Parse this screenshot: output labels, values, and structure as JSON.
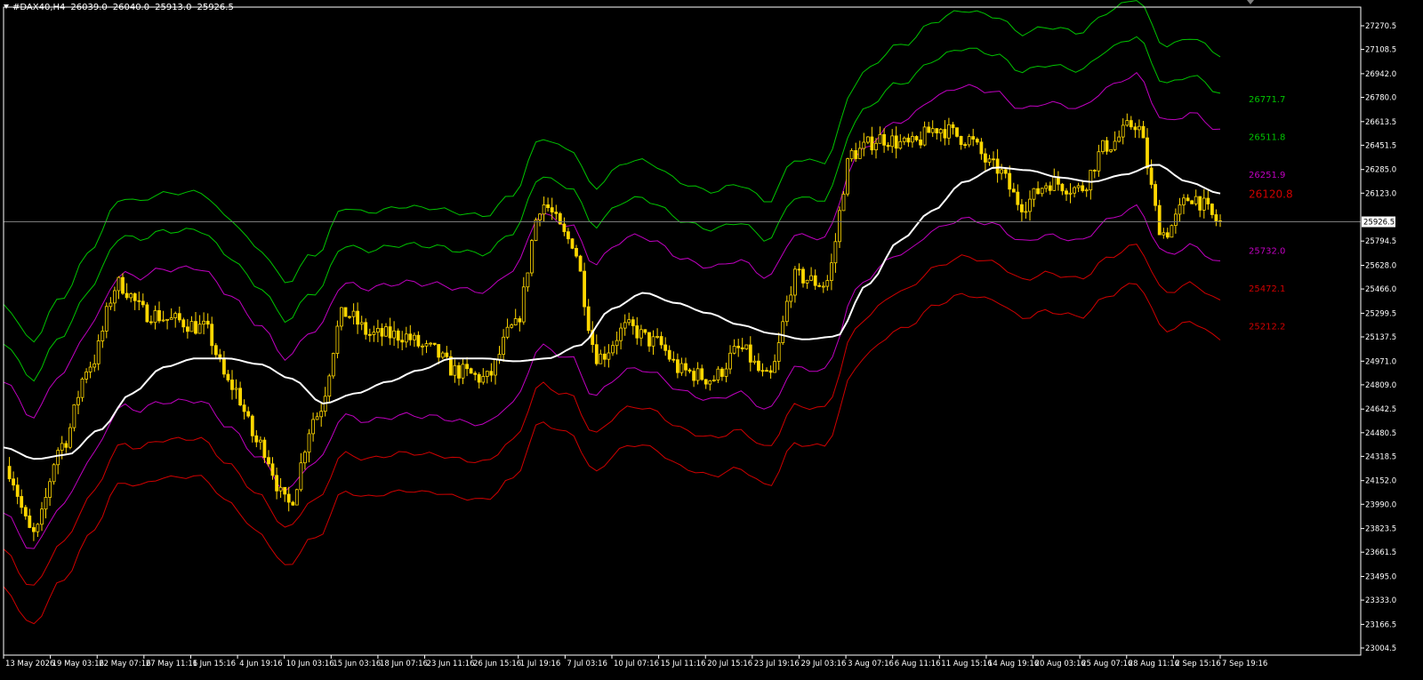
{
  "header": {
    "symbol": "#DAX40,H4",
    "ohlc": [
      "26039.0",
      "26040.0",
      "25913.0",
      "25926.5"
    ]
  },
  "colors": {
    "background": "#000000",
    "axis": "#ffffff",
    "candle": "#ffd700",
    "mid_line": "#ffffff",
    "outer_band": "#00c400",
    "middle_band": "#c000c0",
    "lower_band": "#d00000",
    "price_line": "#7a7a7a"
  },
  "chart_data": {
    "type": "candlestick",
    "instrument": "#DAX40",
    "timeframe": "H4",
    "ylim": [
      23004.5,
      27350
    ],
    "y_ticks": [
      "27270.5",
      "27108.5",
      "26942.0",
      "26780.0",
      "26613.5",
      "26451.5",
      "26285.0",
      "26123.0",
      "25794.5",
      "25628.0",
      "25466.0",
      "25299.5",
      "25137.5",
      "24971.0",
      "24809.0",
      "24642.5",
      "24480.5",
      "24318.5",
      "24152.0",
      "23990.0",
      "23823.5",
      "23661.5",
      "23495.0",
      "23333.0",
      "23166.5",
      "23004.5"
    ],
    "x_ticks": [
      "13 May 2026",
      "19 May 03:16",
      "22 May 07:16",
      "27 May 11:16",
      "1 Jun 15:16",
      "4 Jun 19:16",
      "10 Jun 03:16",
      "15 Jun 03:16",
      "18 Jun 07:16",
      "23 Jun 11:16",
      "26 Jun 15:16",
      "1 Jul 19:16",
      "7 Jul 03:16",
      "10 Jul 07:16",
      "15 Jul 11:16",
      "20 Jul 15:16",
      "23 Jul 19:16",
      "29 Jul 03:16",
      "3 Aug 07:16",
      "6 Aug 11:16",
      "11 Aug 15:16",
      "14 Aug 19:16",
      "20 Aug 03:16",
      "25 Aug 07:16",
      "28 Aug 11:16",
      "2 Sep 15:16",
      "7 Sep 19:16"
    ],
    "current_price": "25926.5",
    "current_price_value": 25926.5,
    "band_labels": [
      {
        "text": "26771.7",
        "value": 26771.7,
        "band": "outer"
      },
      {
        "text": "26511.8",
        "value": 26511.8,
        "band": "outer"
      },
      {
        "text": "26251.9",
        "value": 26251.9,
        "band": "middle"
      },
      {
        "text": "26120.8",
        "value": 26120.8,
        "band": "mid"
      },
      {
        "text": "25732.0",
        "value": 25732.0,
        "band": "middle"
      },
      {
        "text": "25472.1",
        "value": 25472.1,
        "band": "lower"
      },
      {
        "text": "25212.2",
        "value": 25212.2,
        "band": "lower"
      }
    ],
    "mid_line": [
      24380,
      24300,
      24330,
      24500,
      24750,
      24930,
      24990,
      24990,
      24950,
      24850,
      24680,
      24750,
      24830,
      24910,
      24990,
      24990,
      24970,
      24990,
      25080,
      25330,
      25440,
      25370,
      25300,
      25220,
      25160,
      25120,
      25140,
      25500,
      25800,
      26000,
      26200,
      26300,
      26280,
      26230,
      26200,
      26250,
      26320,
      26200,
      26120.8
    ],
    "band_offsets": [
      1039.4,
      779.5,
      519.6,
      -389.8,
      -649.7,
      -909.6
    ],
    "candle_path": [
      24250,
      23780,
      24400,
      24950,
      25500,
      25300,
      25250,
      25200,
      24800,
      24400,
      23990,
      24600,
      25300,
      25150,
      25150,
      25050,
      24900,
      24850,
      25200,
      26050,
      25800,
      25000,
      25200,
      25100,
      24900,
      24850,
      25050,
      24850,
      25550,
      25500,
      26400,
      26500,
      26450,
      26570,
      26500,
      26300,
      26050,
      26200,
      26150,
      26450,
      26600,
      25850,
      26100,
      25926.5
    ]
  }
}
